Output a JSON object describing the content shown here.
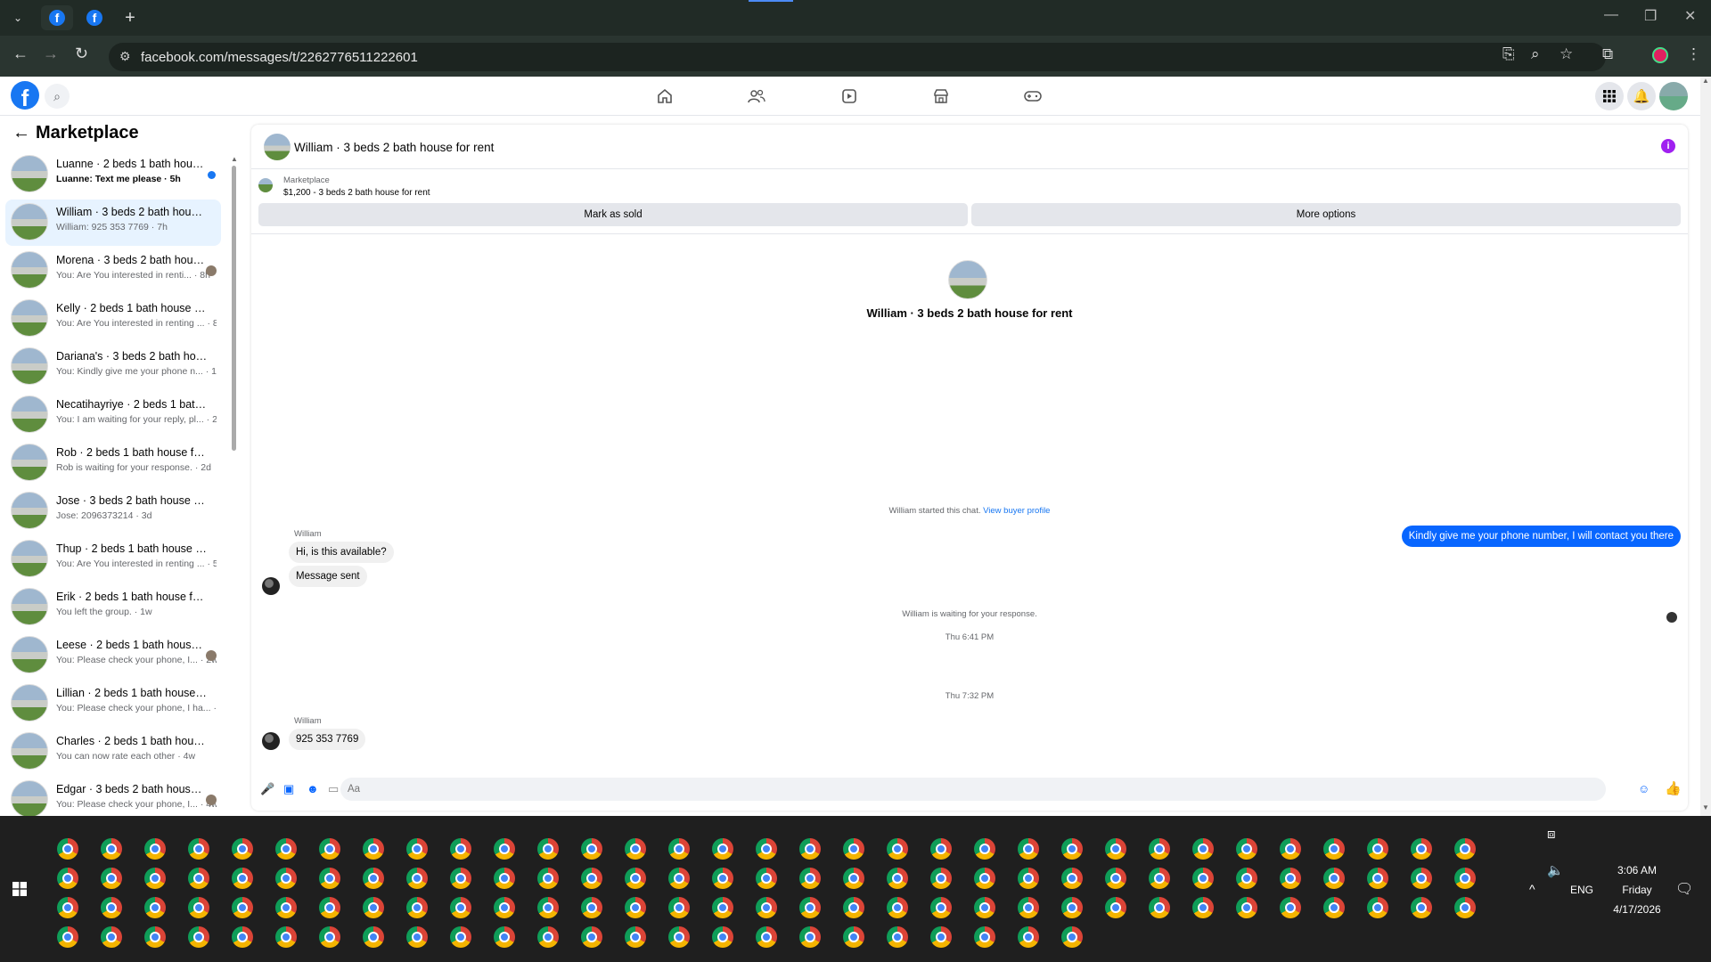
{
  "browser": {
    "url": "facebook.com/messages/t/2262776511222601"
  },
  "sidebar": {
    "title": "Marketplace",
    "conversations": [
      {
        "name": "Luanne · 2 beds 1 bath house ...",
        "preview": "Luanne: Text me please · 5h",
        "unread": true
      },
      {
        "name": "William · 3 beds 2 bath house f...",
        "preview": "William: 925 353 7769 · 7h",
        "active": true
      },
      {
        "name": "Morena · 3 beds 2 bath hous...",
        "preview": "You: Are You interested in renti... · 8h"
      },
      {
        "name": "Kelly · 2 beds 1 bath house for r...",
        "preview": "You: Are You interested in renting ... · 8h"
      },
      {
        "name": "Dariana's · 3 beds 2 bath house ...",
        "preview": "You: Kindly give me your phone n... · 1d"
      },
      {
        "name": "Necatihayriye · 2 beds 1 bath h...",
        "preview": "You: I am waiting for your reply, pl... · 2d"
      },
      {
        "name": "Rob · 2 beds 1 bath house for re...",
        "preview": "Rob is waiting for your response. · 2d"
      },
      {
        "name": "Jose · 3 beds 2 bath house for r...",
        "preview": "Jose: 2096373214 · 3d"
      },
      {
        "name": "Thup · 2 beds 1 bath house for r...",
        "preview": "You: Are You interested in renting ... · 5d"
      },
      {
        "name": "Erik · 2 beds 1 bath house for rent",
        "preview": "You left the group. · 1w"
      },
      {
        "name": "Leese · 2 beds 1 bath house f...",
        "preview": "You: Please check your phone, I... · 2w"
      },
      {
        "name": "Lillian · 2 beds 1 bath house for ...",
        "preview": "You: Please check your phone, I ha... · 3w"
      },
      {
        "name": "Charles · 2 beds 1 bath house fo...",
        "preview": "You can now rate each other · 4w"
      },
      {
        "name": "Edgar · 3 beds 2 bath house f...",
        "preview": "You: Please check your phone, I... · 4w"
      }
    ]
  },
  "chat": {
    "title": "William · 3 beds 2 bath house for rent",
    "marketplace_label": "Marketplace",
    "listing": "$1,200 - 3 beds 2 bath house for rent",
    "mark_sold": "Mark as sold",
    "more_options": "More options",
    "intro_title": "William · 3 beds 2 bath house for rent",
    "started_text": "William started this chat.",
    "view_profile": "View buyer profile",
    "sender": "William",
    "msg1": "Hi, is this available?",
    "msg2": "Message sent",
    "waiting": "William is waiting for your response.",
    "time1": "Thu 6:41 PM",
    "outgoing": "Kindly give me your phone number, I will contact you there",
    "time2": "Thu 7:32 PM",
    "msg3": "925 353 7769",
    "placeholder": "Aa"
  },
  "tray": {
    "lang": "ENG",
    "time": "3:06 AM",
    "day": "Friday",
    "date": "4/17/2026"
  },
  "colors": {
    "fb_blue": "#1877f2",
    "messenger_blue": "#0866ff",
    "taskbar": "#1f1f1f"
  }
}
